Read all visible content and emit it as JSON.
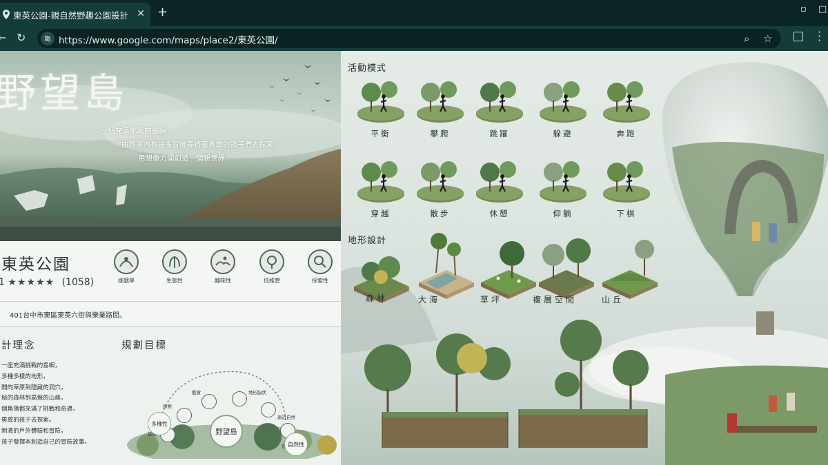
{
  "browser": {
    "tab_title": "東英公園-親自然野趣公園設計",
    "tab_close": "✕",
    "new_tab": "+",
    "url": "https://www.google.com/maps/place2/東英公園/"
  },
  "hero": {
    "title": "野望島",
    "lines": [
      "一個充滿挑戰的島嶼",
      "由園區內有許多冒險等待著勇敢的孩子們去探索",
      "用想像力開創這一個新世界"
    ]
  },
  "place": {
    "name": "東英公園",
    "rating_value": "1",
    "stars": "★★★★★",
    "review_count": "(1058)",
    "address": "401台中市東區東英六街與樂業路間。",
    "badges": [
      "挑戰學",
      "生態性",
      "趣味性",
      "低維管",
      "探索性"
    ]
  },
  "concept": {
    "heading": "計理念",
    "lines": [
      "一座充滿挑戰的島嶼，",
      "多種多樣的地形，",
      "開的草原到隱藏的洞穴，",
      "秘的森林到高聳的山峰，",
      "個角落都充滿了挑戰和奇遇，",
      "勇敢的孩子去探索。",
      "刺激的戶外體驗和冒險，",
      "孩子發揮本創造自己的冒險故事。"
    ]
  },
  "goals": {
    "heading": "規劃目標",
    "center": "野望島",
    "nodes": [
      "挑戰",
      "探索",
      "鑑賞",
      "趣味",
      "地形起伏",
      "親近自然",
      "低維管"
    ],
    "tags": [
      "多樣性",
      "自然性"
    ]
  },
  "activities": {
    "heading": "活動模式",
    "items": [
      "平衡",
      "攀爬",
      "跳躍",
      "躲避",
      "奔跑",
      "穿越",
      "散步",
      "休憩",
      "仰躺",
      "下棋"
    ]
  },
  "terrain": {
    "heading": "地形設計",
    "items": [
      "森林",
      "大海",
      "草坪",
      "複層空間",
      "山丘"
    ]
  },
  "colors": {
    "chrome_dark": "#0c2625",
    "chrome": "#143c3a",
    "panel_text": "#2b3a33",
    "accent_green": "#5f8a5c"
  }
}
